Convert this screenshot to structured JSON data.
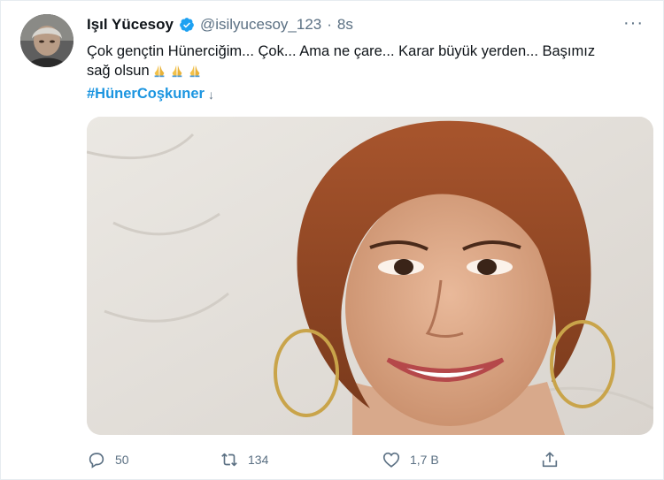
{
  "tweet": {
    "author": {
      "name": "Işıl Yücesoy",
      "handle": "@isilyucesoy_123",
      "separator": "·",
      "time": "8s"
    },
    "more_label": "···",
    "text_line1": "Çok gençtin Hünerciğim... Çok... Ama ne çare... Karar büyük yerden... Başımız",
    "text_line2": "sağ olsun",
    "emoji": [
      "folded-hands",
      "folded-hands",
      "folded-hands"
    ],
    "hashtag": "#HünerCoşkuner",
    "hashtag_suffix": "↓",
    "stats": {
      "replies": "50",
      "retweets": "134",
      "likes": "1,7 B"
    }
  },
  "colors": {
    "link": "#1b95e0",
    "muted": "#5b7083",
    "verified": "#1da1f2",
    "text": "#0f1419"
  },
  "icons": {
    "reply": "reply-icon",
    "retweet": "retweet-icon",
    "like": "heart-icon",
    "share": "share-icon",
    "verified": "verified-badge-icon",
    "more": "more-icon"
  }
}
